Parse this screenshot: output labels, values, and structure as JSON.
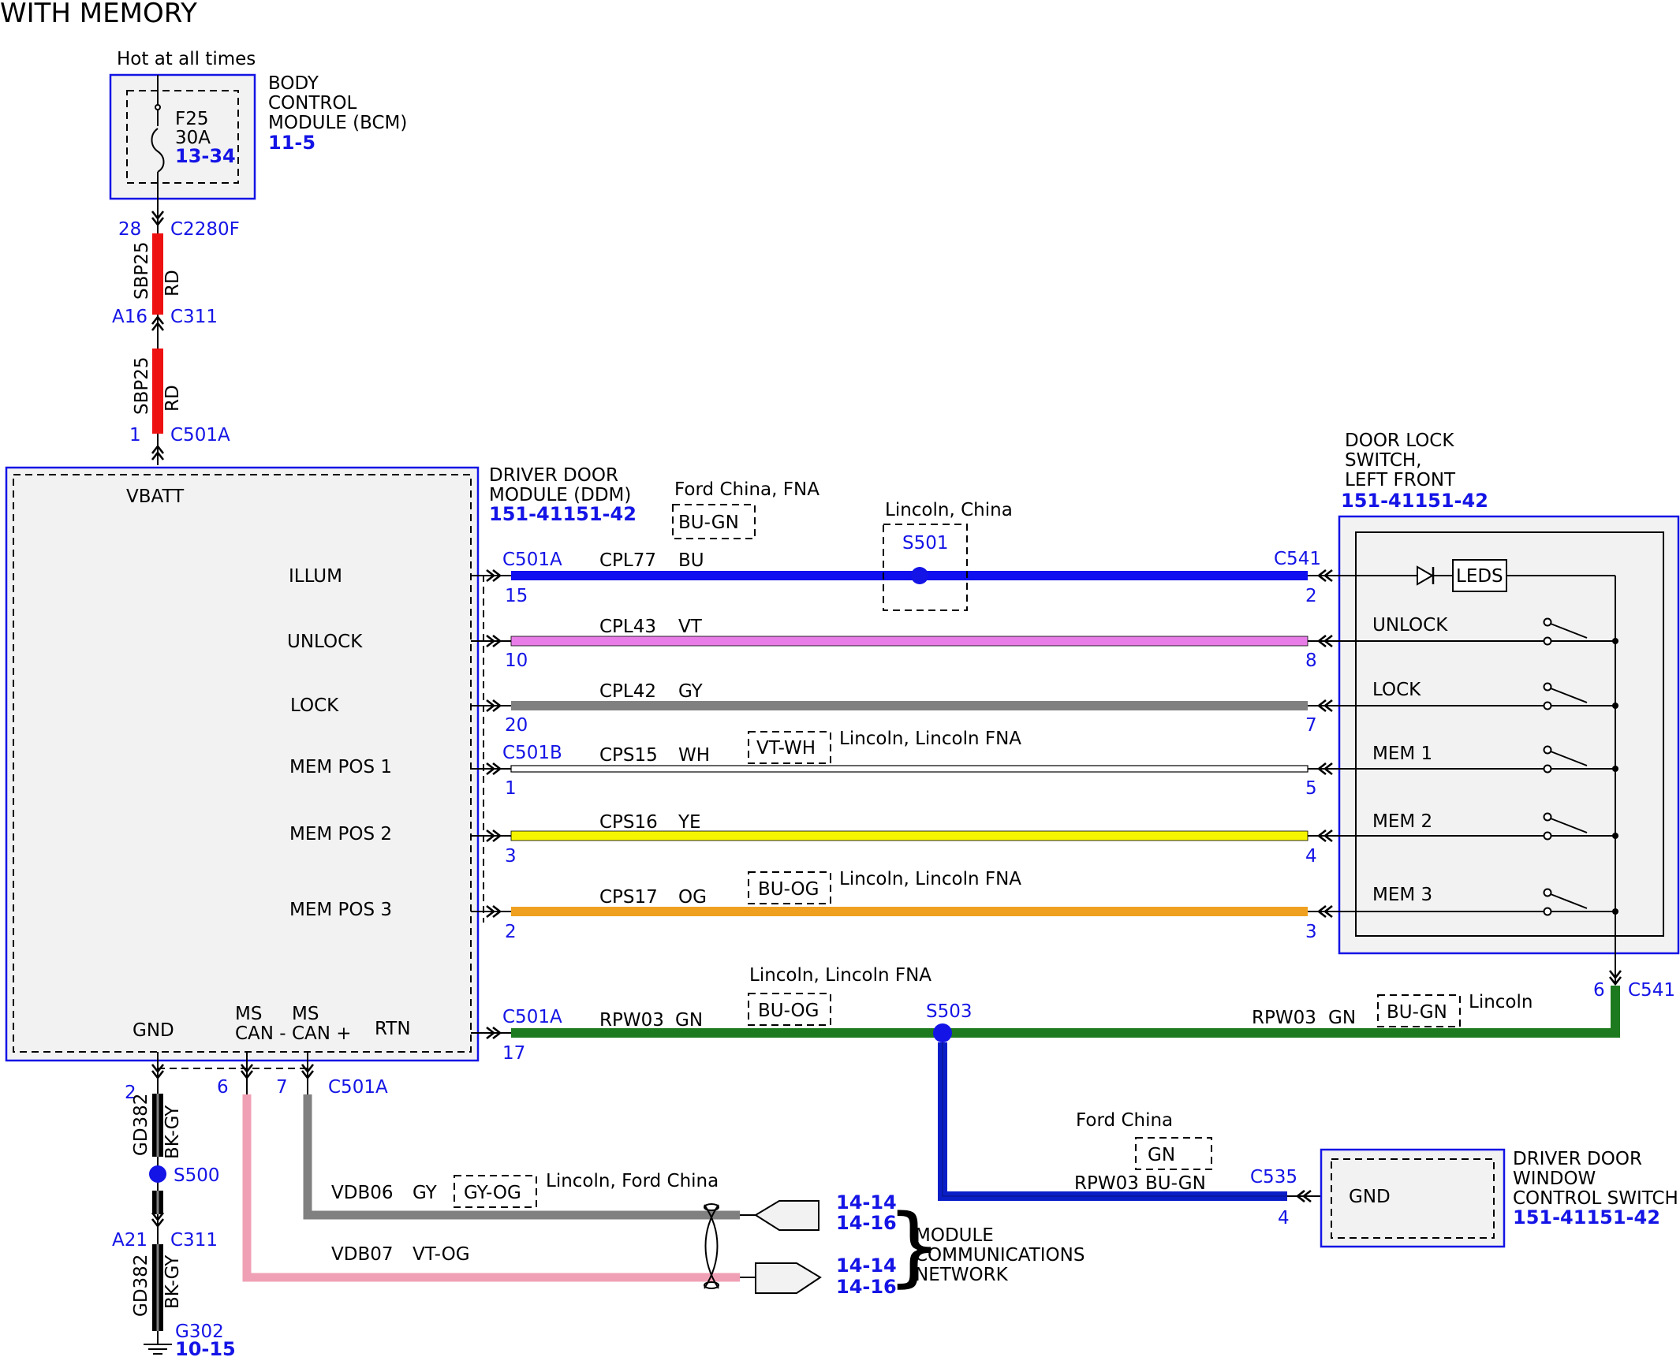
{
  "title": "WITH MEMORY",
  "bcm": {
    "hot_label": "Hot at all times",
    "name": [
      "BODY",
      "CONTROL",
      "MODULE (BCM)"
    ],
    "ref": "11-5",
    "fuse": {
      "id": "F25",
      "rating": "30A",
      "ref": "13-34"
    }
  },
  "power_feed": {
    "upper": {
      "pin_top": "28",
      "conn_top": "C2280F",
      "circuit": "SBP25",
      "color": "RD",
      "pin_bottom": "A16",
      "conn_bottom": "C311"
    },
    "lower": {
      "circuit": "SBP25",
      "color": "RD",
      "pin": "1",
      "conn": "C501A"
    }
  },
  "ddm": {
    "name": [
      "DRIVER DOOR",
      "MODULE (DDM)"
    ],
    "ref": "151-41151-42",
    "pins": {
      "vbatt": "VBATT",
      "illum": "ILLUM",
      "unlock": "UNLOCK",
      "lock": "LOCK",
      "mem1": "MEM POS 1",
      "mem2": "MEM POS 2",
      "mem3": "MEM POS 3",
      "gnd": "GND",
      "ms_can_minus": [
        "MS",
        "CAN -"
      ],
      "ms_can_plus": [
        "MS",
        "CAN +"
      ],
      "rtn": "RTN"
    }
  },
  "switch": {
    "name": [
      "DOOR LOCK",
      "SWITCH,",
      "LEFT FRONT"
    ],
    "ref": "151-41151-42",
    "leds": "LEDS",
    "items": {
      "unlock": "UNLOCK",
      "lock": "LOCK",
      "mem1": "MEM 1",
      "mem2": "MEM 2",
      "mem3": "MEM 3"
    },
    "ret_pin": "6",
    "ret_conn": "C541"
  },
  "circuits": {
    "illum": {
      "conn_left": "C501A",
      "pin_left": "15",
      "circuit": "CPL77",
      "color": "BU",
      "conn_right": "C541",
      "pin_right": "2",
      "hex": "#0f0ff0"
    },
    "unlock": {
      "pin_left": "10",
      "circuit": "CPL43",
      "color": "VT",
      "pin_right": "8",
      "hex": "#e87de8"
    },
    "lock": {
      "pin_left": "20",
      "circuit": "CPL42",
      "color": "GY",
      "pin_right": "7",
      "hex": "#808080"
    },
    "mem1": {
      "conn_left": "C501B",
      "pin_left": "1",
      "circuit": "CPS15",
      "color": "WH",
      "pin_right": "5",
      "hex": "#ffffff"
    },
    "mem2": {
      "pin_left": "3",
      "circuit": "CPS16",
      "color": "YE",
      "pin_right": "4",
      "hex": "#f5f500"
    },
    "mem3": {
      "pin_left": "2",
      "circuit": "CPS17",
      "color": "OG",
      "pin_right": "3",
      "hex": "#f0a020"
    }
  },
  "options": {
    "ford_china_fna": "Ford China, FNA",
    "bu_gn": "BU-GN",
    "lincoln_china": "Lincoln, China",
    "s501": "S501",
    "vt_wh": "VT-WH",
    "lincoln_lincoln_fna_1": "Lincoln, Lincoln FNA",
    "bu_og_1": "BU-OG",
    "lincoln_lincoln_fna_2": "Lincoln, Lincoln FNA"
  },
  "rtn": {
    "conn": "C501A",
    "pin": "17",
    "circuit": "RPW03",
    "color": "GN",
    "option_label": "Lincoln, Lincoln FNA",
    "option_color": "BU-OG",
    "splice": "S503",
    "right_circuit": "RPW03",
    "right_color": "GN",
    "right_option_color": "BU-GN",
    "right_option_label": "Lincoln",
    "hex": "#1e7a1e"
  },
  "window_switch": {
    "name": [
      "DRIVER DOOR",
      "WINDOW",
      "CONTROL SWITCH"
    ],
    "ref": "151-41151-42",
    "gnd": "GND",
    "conn": "C535",
    "pin": "4",
    "circuit": "RPW03",
    "color": "BU-GN",
    "option_label": "Ford China",
    "option_color": "GN",
    "hex": "#0a1ec8"
  },
  "ground": {
    "pin_top": "2",
    "circuit": "GD382",
    "color": "BK-GY",
    "splice": "S500",
    "pin_mid": "A21",
    "conn_mid": "C311",
    "ground_id": "G302",
    "ground_ref": "10-15"
  },
  "can": {
    "pin_minus": "6",
    "pin_plus": "7",
    "conn": "C501A",
    "plus_circuit": "VDB06",
    "plus_color": "GY",
    "plus_option_color": "GY-OG",
    "plus_option_label": "Lincoln, Ford China",
    "minus_circuit": "VDB07",
    "minus_color": "VT-OG",
    "refs_a": [
      "14-14",
      "14-16"
    ],
    "refs_b": [
      "14-14",
      "14-16"
    ],
    "network": [
      "MODULE",
      "COMMUNICATIONS",
      "NETWORK"
    ],
    "bracket": "}"
  },
  "colors": {
    "blue_label": "#1414e6",
    "module_fill": "#f2f2f2",
    "power_red": "#ee1111",
    "ground_black": "#000000",
    "can_gray": "#808080",
    "can_pink": "#f0a0b4"
  }
}
